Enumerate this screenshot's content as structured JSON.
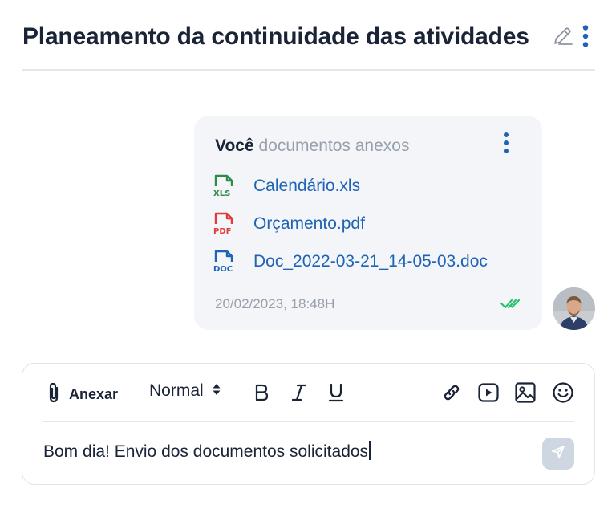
{
  "header": {
    "title": "Planeamento da continuidade das atividades",
    "edit_icon": "pencil-icon",
    "menu_icon": "kebab-icon"
  },
  "message": {
    "author": "Você",
    "subtitle": "documentos anexos",
    "attachments": [
      {
        "name": "Calendário.xls",
        "type": "XLS",
        "color": "#2e8b4a"
      },
      {
        "name": "Orçamento.pdf",
        "type": "PDF",
        "color": "#e03a3a"
      },
      {
        "name": "Doc_2022-03-21_14-05-03.doc",
        "type": "DOC",
        "color": "#1e63b5"
      }
    ],
    "timestamp": "20/02/2023, 18:48H",
    "status_icon": "double-check-icon",
    "status_color": "#2fbf71"
  },
  "composer": {
    "attach_label": "Anexar",
    "format_label": "Normal",
    "input_value": "Bom dia! Envio dos documentos solicitados",
    "tools": [
      "bold-icon",
      "italic-icon",
      "underline-icon",
      "link-icon",
      "video-icon",
      "image-icon",
      "emoji-icon"
    ],
    "send_icon": "send-icon"
  },
  "colors": {
    "accent": "#1e63b5",
    "text": "#1b2436",
    "muted": "#98a0ab",
    "bubble_bg": "#f3f5f8"
  }
}
